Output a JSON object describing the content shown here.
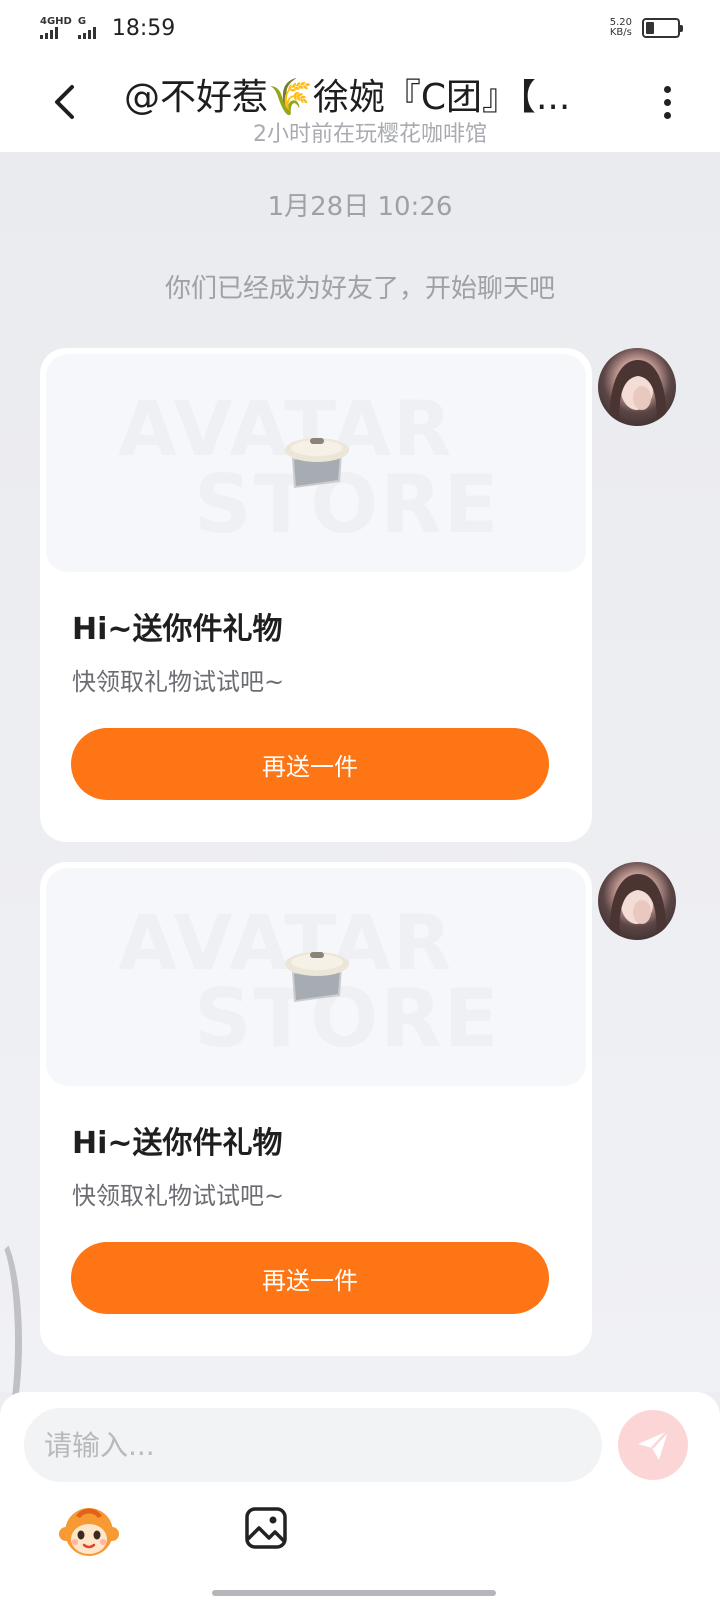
{
  "status_bar": {
    "network_1": "4GHD",
    "network_2": "G",
    "time": "18:59",
    "net_speed_value": "5.20",
    "net_speed_unit": "KB/s",
    "battery_level": 0.25
  },
  "header": {
    "title": "@不好惹🌾徐婉『C团』【...",
    "subtitle": "2小时前在玩樱花咖啡馆",
    "back_icon": "chevron-left-icon",
    "more_icon": "more-vertical-icon"
  },
  "chat": {
    "timestamp": "1月28日 10:26",
    "system_message": "你们已经成为好友了，开始聊天吧",
    "messages": [
      {
        "watermark_1": "AVATAR",
        "watermark_2": "STORE",
        "title": "Hi~送你件礼物",
        "description": "快领取礼物试试吧~",
        "button_label": "再送一件"
      },
      {
        "watermark_1": "AVATAR",
        "watermark_2": "STORE",
        "title": "Hi~送你件礼物",
        "description": "快领取礼物试试吧~",
        "button_label": "再送一件"
      }
    ]
  },
  "input": {
    "placeholder": "请输入...",
    "send_icon": "send-icon",
    "emoji_icon": "monkey-emoji-icon",
    "image_icon": "image-icon"
  },
  "colors": {
    "accent": "#fd7514",
    "send_disabled": "#fcd6d6",
    "background": "#eceef2"
  }
}
